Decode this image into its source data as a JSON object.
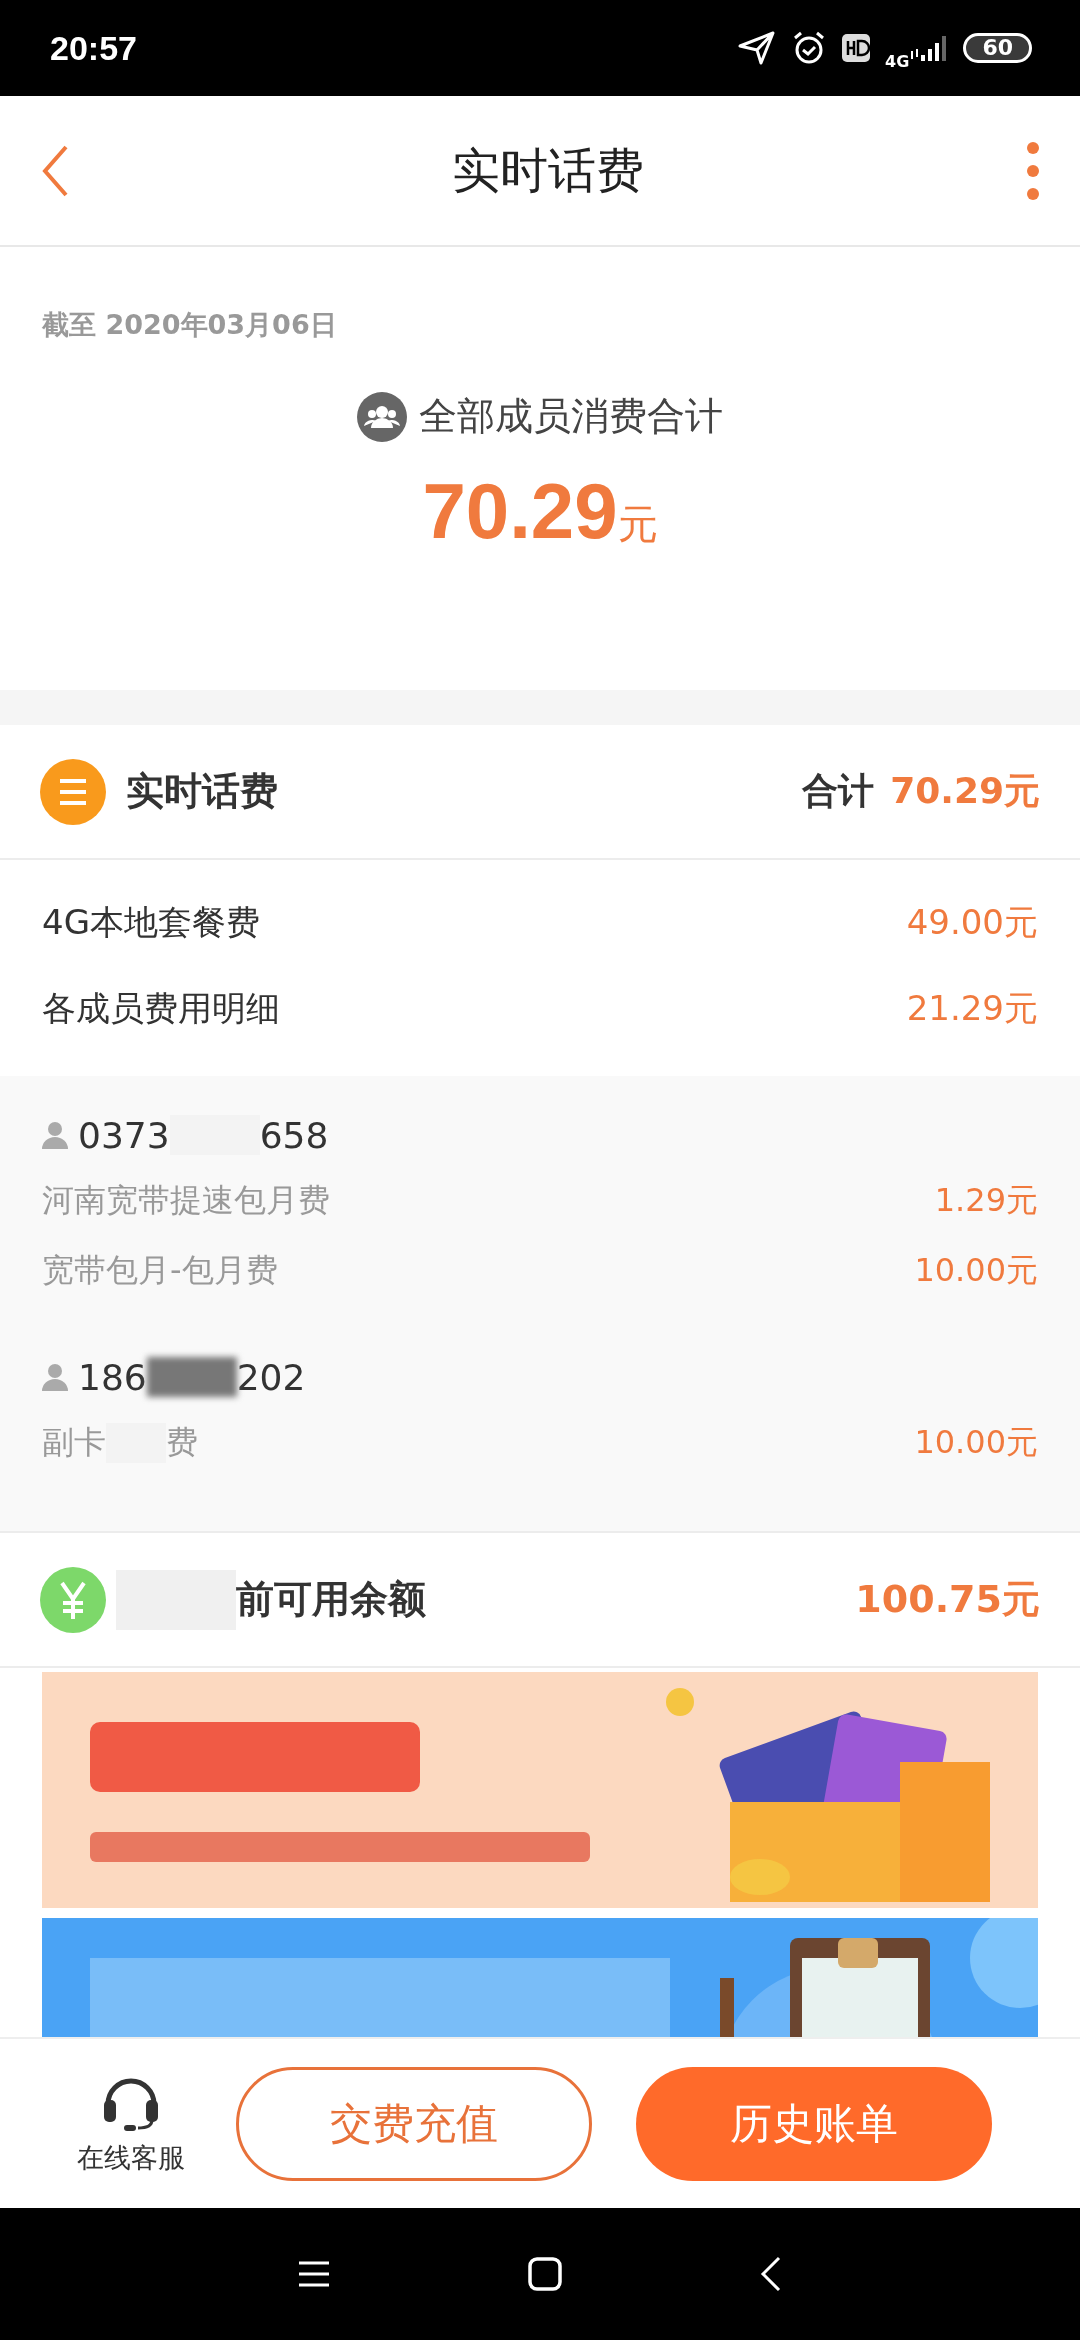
{
  "status_bar": {
    "time": "20:57",
    "network": "4G",
    "battery": "60"
  },
  "header": {
    "title": "实时话费"
  },
  "summary": {
    "date": "截至 2020年03月06日",
    "label": "全部成员消费合计",
    "amount": "70.29",
    "unit": "元"
  },
  "bill": {
    "title": "实时话费",
    "total_label": "合计",
    "total": "70.29元",
    "items": [
      {
        "name": "4G本地套餐费",
        "amount": "49.00元"
      },
      {
        "name": "各成员费用明细",
        "amount": "21.29元"
      }
    ]
  },
  "members": [
    {
      "number_start": "0373",
      "number_end": "658",
      "fees": [
        {
          "name": "河南宽带提速包月费",
          "amount": "1.29元"
        },
        {
          "name": "宽带包月-包月费",
          "amount": "10.00元"
        }
      ]
    },
    {
      "number_start": "186",
      "number_end": "202",
      "fees": [
        {
          "name_start": "副卡",
          "name_end": "费",
          "amount": "10.00元"
        }
      ]
    }
  ],
  "balance": {
    "label": "前可用余额",
    "amount": "100.75元"
  },
  "bottom_bar": {
    "service": "在线客服",
    "recharge": "交费充值",
    "history": "历史账单"
  }
}
